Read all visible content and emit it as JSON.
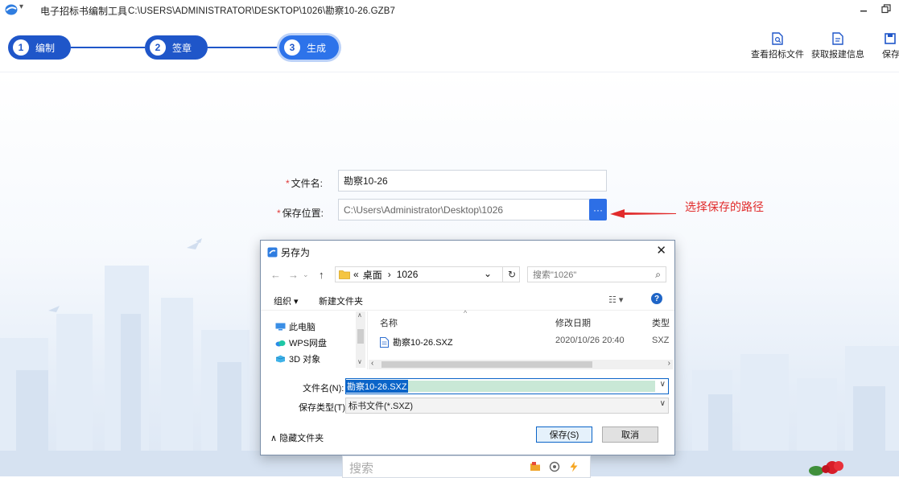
{
  "titlebar": {
    "app_name": "电子招标书编制工具",
    "file_path": "C:\\USERS\\ADMINISTRATOR\\DESKTOP\\1026\\勘察10-26.GZB7",
    "minimize": "–",
    "restore": "🗗"
  },
  "steps": [
    {
      "num": "1",
      "label": "编制"
    },
    {
      "num": "2",
      "label": "签章"
    },
    {
      "num": "3",
      "label": "生成"
    }
  ],
  "toolbar": {
    "view_bid_label": "查看招标文件",
    "get_info_label": "获取报建信息",
    "save_label": "保存"
  },
  "form": {
    "filename_label": "文件名:",
    "filename_value": "勘察10-26",
    "save_location_label": "保存位置:",
    "save_location_value": "C:\\Users\\Administrator\\Desktop\\1026",
    "browse_label": "···",
    "required_mark": "*",
    "annotation": "选择保存的路径"
  },
  "dialog": {
    "title": "另存为",
    "close": "✕",
    "address": {
      "prefix": "«",
      "crumb1": "桌面",
      "sep": "›",
      "crumb2": "1026",
      "dropdown": "⌄",
      "refresh": "↻"
    },
    "search_placeholder": "搜索\"1026\"",
    "organize_label": "组织 ▾",
    "new_folder_label": "新建文件夹",
    "help": "?",
    "tree": [
      {
        "label": "此电脑"
      },
      {
        "label": "WPS网盘"
      },
      {
        "label": "3D 对象"
      }
    ],
    "columns": {
      "name": "名称",
      "modified": "修改日期",
      "type": "类型"
    },
    "files": [
      {
        "name": "勘察10-26.SXZ",
        "modified": "2020/10/26 20:40",
        "type": "SXZ"
      }
    ],
    "filename_field_label": "文件名(N):",
    "filename_field_value": "勘察10-26.SXZ",
    "filetype_label": "保存类型(T):",
    "filetype_value": "标书文件(*.SXZ)",
    "hide_folders_label": "∧ 隐藏文件夹",
    "save_button": "保存(S)",
    "cancel_button": "取消"
  },
  "bottom_search": {
    "placeholder": "搜索"
  },
  "colors": {
    "accent": "#1f56c9",
    "annotation": "#e12b2b",
    "required": "#e03a3a"
  }
}
